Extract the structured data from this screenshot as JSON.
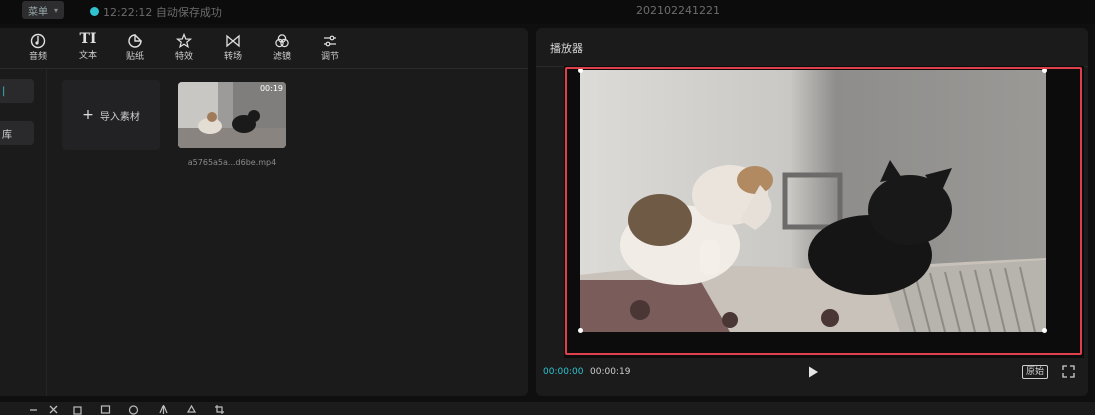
{
  "topbar": {
    "menu_label": "菜单",
    "status_text": "12:22:12 自动保存成功",
    "project_title": "202102241221"
  },
  "toolbar": {
    "tools": [
      {
        "label": "音频",
        "icon": "music-note-icon"
      },
      {
        "label": "文本",
        "icon": "text-icon",
        "glyph": "TI"
      },
      {
        "label": "贴纸",
        "icon": "sticker-icon"
      },
      {
        "label": "特效",
        "icon": "effects-star-icon"
      },
      {
        "label": "转场",
        "icon": "transition-icon"
      },
      {
        "label": "滤镜",
        "icon": "filter-icon"
      },
      {
        "label": "调节",
        "icon": "adjust-sliders-icon"
      }
    ]
  },
  "sidebar": {
    "items": [
      {
        "label": "|"
      },
      {
        "label": "库"
      }
    ]
  },
  "media": {
    "import_label": "导入素材",
    "clip": {
      "duration": "00:19",
      "filename": "a5765a5a...d6be.mp4"
    }
  },
  "player": {
    "title": "播放器",
    "current_time": "00:00:00",
    "total_time": "00:00:19",
    "ratio_label": "原始",
    "highlight_color": "#e0404b",
    "accent_color": "#2fc2cf"
  }
}
